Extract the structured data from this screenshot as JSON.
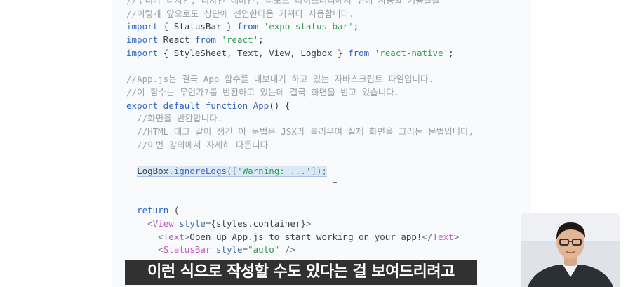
{
  "editor": {
    "lines": [
      {
        "segs": [
          {
            "c": "cm",
            "t": "//우리가 디자인, 디자인 테마인, 리모트 라이브러리에서 위에 사용할 기능들을"
          }
        ]
      },
      {
        "segs": [
          {
            "c": "cm",
            "t": "//이렇게 앞으로도 상단에 선언한다음 가져다 사용합니다."
          }
        ]
      },
      {
        "segs": [
          {
            "c": "kw",
            "t": "import"
          },
          {
            "c": "ty",
            "t": " { StatusBar } "
          },
          {
            "c": "kw",
            "t": "from"
          },
          {
            "c": "ty",
            "t": " "
          },
          {
            "c": "st",
            "t": "'expo-status-bar'"
          },
          {
            "c": "ty",
            "t": ";"
          }
        ]
      },
      {
        "segs": [
          {
            "c": "kw",
            "t": "import"
          },
          {
            "c": "ty",
            "t": " React "
          },
          {
            "c": "kw",
            "t": "from"
          },
          {
            "c": "ty",
            "t": " "
          },
          {
            "c": "st",
            "t": "'react'"
          },
          {
            "c": "ty",
            "t": ";"
          }
        ]
      },
      {
        "segs": [
          {
            "c": "kw",
            "t": "import"
          },
          {
            "c": "ty",
            "t": " { StyleSheet, Text, View, Logbox } "
          },
          {
            "c": "kw",
            "t": "from"
          },
          {
            "c": "ty",
            "t": " "
          },
          {
            "c": "st",
            "t": "'react-native'"
          },
          {
            "c": "ty",
            "t": ";"
          }
        ]
      },
      {
        "segs": []
      },
      {
        "segs": [
          {
            "c": "cm",
            "t": "//App.js는 결국 App 함수를 내보내기 하고 있는 자바스크립트 파일입니다."
          }
        ]
      },
      {
        "segs": [
          {
            "c": "cm",
            "t": "//이 함수는 무언가?를 반환하고 있는데 결국 화면을 반고 있습니다."
          }
        ]
      },
      {
        "segs": [
          {
            "c": "kw",
            "t": "export default function"
          },
          {
            "c": "ty",
            "t": " "
          },
          {
            "c": "fn",
            "t": "App"
          },
          {
            "c": "ty",
            "t": "() {"
          }
        ]
      },
      {
        "segs": [
          {
            "c": "cm",
            "t": "  //화면을 반환합니다."
          }
        ]
      },
      {
        "segs": [
          {
            "c": "cm",
            "t": "  //HTML 태그 같이 생긴 이 문법은 JSX라 불리우며 실제 화면을 그리는 문법입니다,"
          }
        ]
      },
      {
        "segs": [
          {
            "c": "cm",
            "t": "  //이번 강의에서 자세히 다룹니다"
          }
        ]
      },
      {
        "segs": []
      },
      {
        "segs": [
          {
            "c": "ty",
            "t": "  "
          },
          {
            "c": "ty hl",
            "t": "LogBox"
          },
          {
            "c": "pl hl",
            "t": "."
          },
          {
            "c": "fn hl",
            "t": "ignoreLogs"
          },
          {
            "c": "pl hl",
            "t": "(["
          },
          {
            "c": "st hl",
            "t": "'Warning: ...'"
          },
          {
            "c": "pl hl",
            "t": "]);"
          }
        ]
      },
      {
        "segs": []
      },
      {
        "segs": []
      },
      {
        "segs": [
          {
            "c": "ty",
            "t": "  "
          },
          {
            "c": "kw",
            "t": "return"
          },
          {
            "c": "ty",
            "t": " ("
          }
        ]
      },
      {
        "segs": [
          {
            "c": "ty",
            "t": "    "
          },
          {
            "c": "pl",
            "t": "<"
          },
          {
            "c": "tg",
            "t": "View"
          },
          {
            "c": "ty",
            "t": " "
          },
          {
            "c": "fn",
            "t": "style"
          },
          {
            "c": "ty",
            "t": "={styles.container}"
          },
          {
            "c": "pl",
            "t": ">"
          }
        ]
      },
      {
        "segs": [
          {
            "c": "ty",
            "t": "      "
          },
          {
            "c": "pl",
            "t": "<"
          },
          {
            "c": "tg",
            "t": "Text"
          },
          {
            "c": "pl",
            "t": ">"
          },
          {
            "c": "ty",
            "t": "Open up App.js to start working on your app!"
          },
          {
            "c": "pl",
            "t": "</"
          },
          {
            "c": "tg",
            "t": "Text"
          },
          {
            "c": "pl",
            "t": ">"
          }
        ]
      },
      {
        "segs": [
          {
            "c": "ty",
            "t": "      "
          },
          {
            "c": "pl",
            "t": "<"
          },
          {
            "c": "tg",
            "t": "StatusBar"
          },
          {
            "c": "ty",
            "t": " "
          },
          {
            "c": "fn",
            "t": "style"
          },
          {
            "c": "ty",
            "t": "="
          },
          {
            "c": "st",
            "t": "\"auto\""
          },
          {
            "c": "ty",
            "t": " "
          },
          {
            "c": "pl",
            "t": "/>"
          }
        ]
      }
    ]
  },
  "subtitle": {
    "text": "이런 식으로 작성할 수도 있다는 걸 보여드리려고"
  },
  "colors": {
    "editor_bg": "#f9fafb",
    "keyword": "#2f65c4",
    "string": "#2f9e50",
    "comment": "#9aa0a6",
    "tag": "#c15ac3",
    "subtitle_bg": "#141416"
  },
  "icons": {
    "text_cursor": "text-cursor-icon"
  }
}
